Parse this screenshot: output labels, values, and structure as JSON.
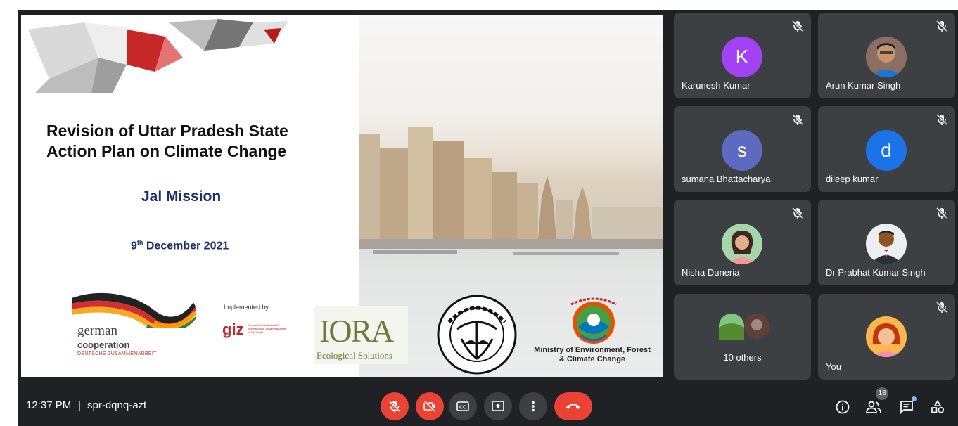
{
  "slide": {
    "title_line1": "Revision of Uttar Pradesh State",
    "title_line2": "Action Plan on Climate Change",
    "subtitle": "Jal Mission",
    "date_day": "9",
    "date_suffix": "th",
    "date_rest": " December 2021",
    "logos": {
      "german_1": "german",
      "german_2": "cooperation",
      "german_3": "DEUTSCHE ZUSAMMENARBEIT",
      "implemented": "Implemented by",
      "giz": "giz",
      "giz_sub": "Deutsche Gesellschaft für Internationale Zusammenarbeit (GIZ) GmbH",
      "iora": "IORA",
      "iora_sub": "Ecological Solutions",
      "moef_1": "Ministry of Environment, Forest",
      "moef_2": "& Climate Change"
    }
  },
  "participants": [
    {
      "name": "Karunesh Kumar",
      "initial": "K",
      "color": "#a142f4",
      "muted": true
    },
    {
      "name": "Arun Kumar Singh",
      "photo": true,
      "muted": true
    },
    {
      "name": "sumana Bhattacharya",
      "initial": "s",
      "color": "#5c6bc0",
      "muted": true
    },
    {
      "name": "dileep kumar",
      "initial": "d",
      "color": "#1a73e8",
      "muted": true
    },
    {
      "name": "Nisha Duneria",
      "photo": true,
      "muted": true
    },
    {
      "name": "Dr Prabhat Kumar Singh",
      "photo": true,
      "muted": true
    },
    {
      "name": "10 others",
      "photo": true,
      "muted": false
    },
    {
      "name": "You",
      "photo": true,
      "muted": true
    }
  ],
  "bottom_bar": {
    "time": "12:37 PM",
    "separator": "|",
    "meeting_code": "spr-dqnq-azt",
    "participant_count": "18",
    "colors": {
      "danger": "#ea4335",
      "control": "#3c4043"
    }
  }
}
